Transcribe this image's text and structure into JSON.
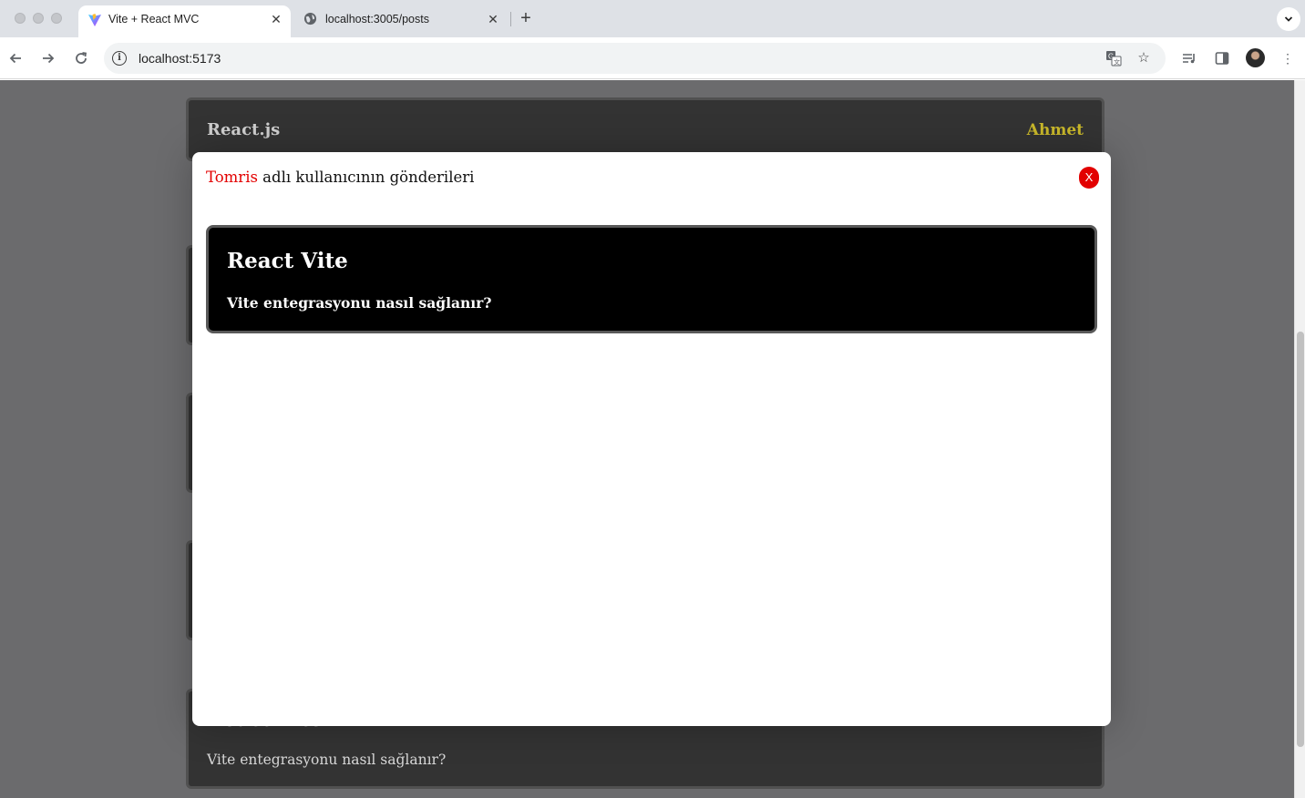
{
  "browser": {
    "tabs": [
      {
        "title": "Vite + React MVC",
        "active": true,
        "icon": "vite-icon"
      },
      {
        "title": "localhost:3005/posts",
        "active": false,
        "icon": "globe-icon"
      }
    ],
    "url": "localhost:5173",
    "close_glyph": "✕",
    "new_tab_glyph": "+"
  },
  "header": {
    "brand": "React.js",
    "user": "Ahmet"
  },
  "background_posts": [
    {
      "title": "React Vite",
      "body": "Vite entegrasyonu nasıl sağlanır?"
    }
  ],
  "modal": {
    "username": "Tomris",
    "title_suffix": " adlı kullanıcının gönderileri",
    "close_label": "X",
    "posts": [
      {
        "title": "React Vite",
        "body": "Vite entegrasyonu nasıl sağlanır?"
      }
    ]
  },
  "colors": {
    "accent_user": "#c9b82a",
    "modal_username": "#e30000",
    "close_button": "#e20000",
    "overlay": "#6b6b6d"
  }
}
